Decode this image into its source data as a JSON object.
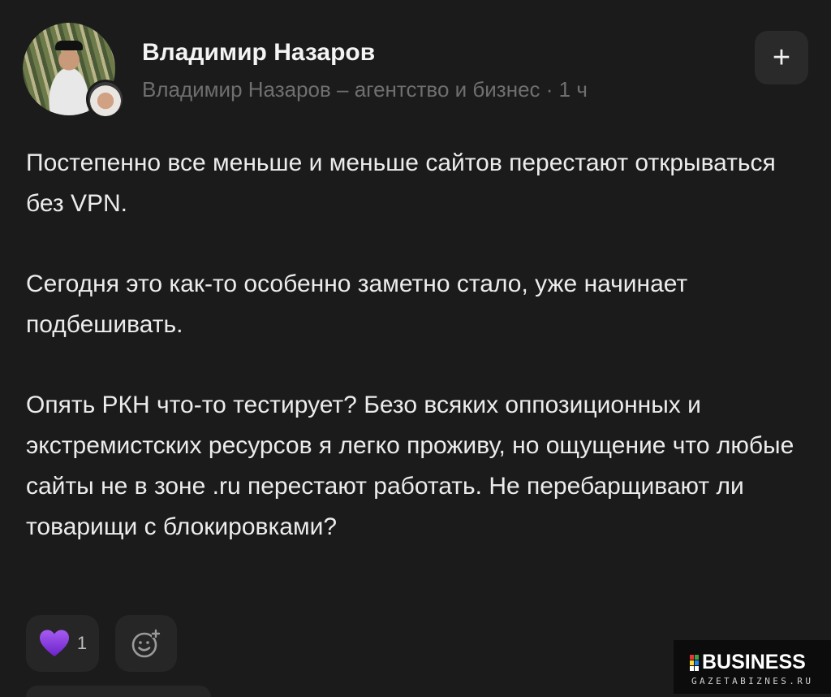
{
  "author": {
    "name": "Владимир Назаров",
    "subline": "Владимир Назаров – агентство и бизнес · 1 ч"
  },
  "header": {
    "add_label": "+"
  },
  "post": {
    "paragraphs": [
      "Постепенно все меньше и меньше сайтов перестают открываться без VPN.",
      "Сегодня это как-то особенно заметно стало, уже начинает подбешивать.",
      "Опять РКН что-то тестирует? Безо всяких оппозиционных и экстремистских ресурсов я легко проживу, но ощущение что любые сайты не в зоне .ru перестают работать. Не перебарщивают ли товарищи с блокировками?"
    ]
  },
  "reactions": {
    "like_icon": "purple-heart-icon",
    "like_count": "1",
    "add_reaction_icon": "add-reaction-icon"
  },
  "watermark": {
    "title": "BUSINESS",
    "subtitle": "GAZETABIZNES.RU"
  },
  "colors": {
    "background": "#1b1b1b",
    "heart": "#8b3fe0",
    "muted_text": "#6f6f6f"
  }
}
